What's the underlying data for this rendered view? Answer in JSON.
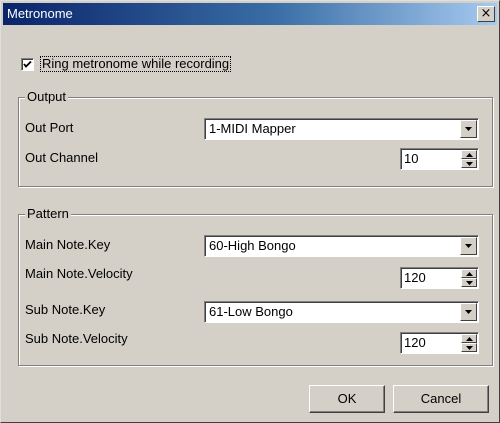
{
  "window": {
    "title": "Metronome",
    "close_label": "×"
  },
  "ring_checkbox": {
    "label": "Ring metronome while recording",
    "checked": true
  },
  "output": {
    "title": "Output",
    "out_port_label": "Out Port",
    "out_port_value": "1-MIDI Mapper",
    "out_channel_label": "Out Channel",
    "out_channel_value": "10"
  },
  "pattern": {
    "title": "Pattern",
    "main_key_label": "Main Note.Key",
    "main_key_value": "60-High Bongo",
    "main_velocity_label": "Main Note.Velocity",
    "main_velocity_value": "120",
    "sub_key_label": "Sub Note.Key",
    "sub_key_value": "61-Low Bongo",
    "sub_velocity_label": "Sub Note.Velocity",
    "sub_velocity_value": "120"
  },
  "buttons": {
    "ok": "OK",
    "cancel": "Cancel"
  },
  "icons": {
    "checkmark": "check-icon",
    "dropdown": "chevron-down-icon",
    "spin_up": "spin-up-icon",
    "spin_down": "spin-down-icon",
    "close": "close-icon"
  },
  "colors": {
    "face": "#d4d0c8",
    "title_start": "#0a246a",
    "title_end": "#a6caf0"
  }
}
